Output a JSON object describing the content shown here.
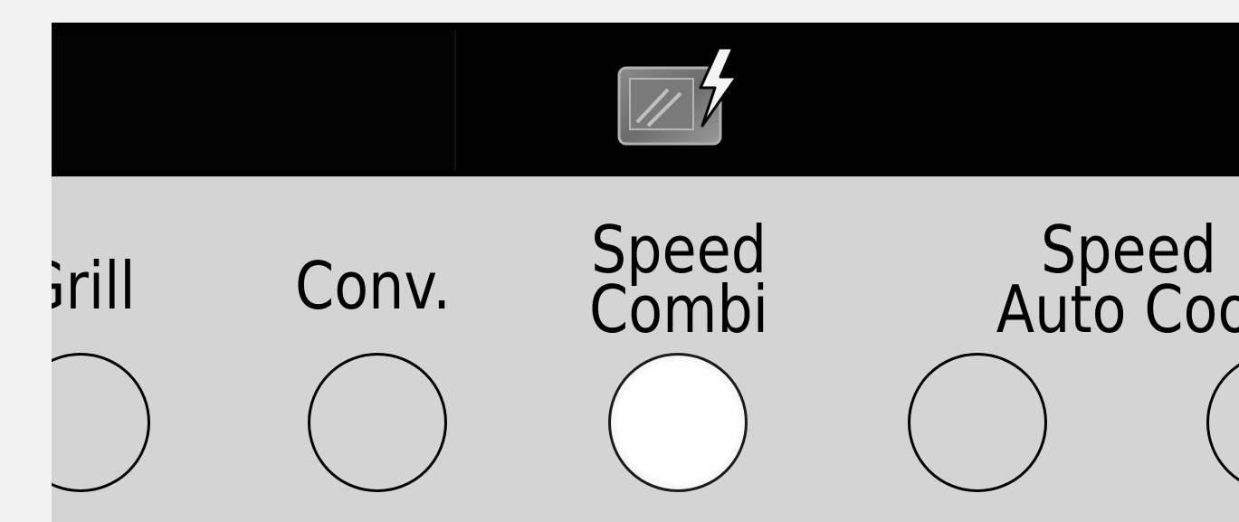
{
  "display": {
    "indicator_icon": "speed-combi-indicator-icon"
  },
  "buttons": [
    {
      "id": "grill",
      "line1": "Grill",
      "line2": "",
      "active": false
    },
    {
      "id": "conv",
      "line1": "Conv.",
      "line2": "",
      "active": false
    },
    {
      "id": "speed-combi",
      "line1": "Speed",
      "line2": "Combi",
      "active": true
    },
    {
      "id": "speed-auto-cook",
      "line1": "Speed",
      "line2": "Auto Cook",
      "active": false
    },
    {
      "id": "next",
      "line1": "",
      "line2": "",
      "active": false
    }
  ],
  "colors": {
    "panel": "#d4d4d4",
    "display": "#000000",
    "active_button": "#ffffff"
  }
}
